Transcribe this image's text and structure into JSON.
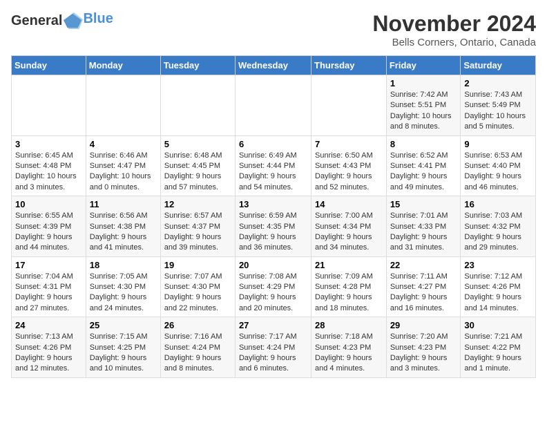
{
  "header": {
    "logo_general": "General",
    "logo_blue": "Blue",
    "month_title": "November 2024",
    "location": "Bells Corners, Ontario, Canada"
  },
  "weekdays": [
    "Sunday",
    "Monday",
    "Tuesday",
    "Wednesday",
    "Thursday",
    "Friday",
    "Saturday"
  ],
  "weeks": [
    [
      {
        "day": "",
        "info": ""
      },
      {
        "day": "",
        "info": ""
      },
      {
        "day": "",
        "info": ""
      },
      {
        "day": "",
        "info": ""
      },
      {
        "day": "",
        "info": ""
      },
      {
        "day": "1",
        "info": "Sunrise: 7:42 AM\nSunset: 5:51 PM\nDaylight: 10 hours and 8 minutes."
      },
      {
        "day": "2",
        "info": "Sunrise: 7:43 AM\nSunset: 5:49 PM\nDaylight: 10 hours and 5 minutes."
      }
    ],
    [
      {
        "day": "3",
        "info": "Sunrise: 6:45 AM\nSunset: 4:48 PM\nDaylight: 10 hours and 3 minutes."
      },
      {
        "day": "4",
        "info": "Sunrise: 6:46 AM\nSunset: 4:47 PM\nDaylight: 10 hours and 0 minutes."
      },
      {
        "day": "5",
        "info": "Sunrise: 6:48 AM\nSunset: 4:45 PM\nDaylight: 9 hours and 57 minutes."
      },
      {
        "day": "6",
        "info": "Sunrise: 6:49 AM\nSunset: 4:44 PM\nDaylight: 9 hours and 54 minutes."
      },
      {
        "day": "7",
        "info": "Sunrise: 6:50 AM\nSunset: 4:43 PM\nDaylight: 9 hours and 52 minutes."
      },
      {
        "day": "8",
        "info": "Sunrise: 6:52 AM\nSunset: 4:41 PM\nDaylight: 9 hours and 49 minutes."
      },
      {
        "day": "9",
        "info": "Sunrise: 6:53 AM\nSunset: 4:40 PM\nDaylight: 9 hours and 46 minutes."
      }
    ],
    [
      {
        "day": "10",
        "info": "Sunrise: 6:55 AM\nSunset: 4:39 PM\nDaylight: 9 hours and 44 minutes."
      },
      {
        "day": "11",
        "info": "Sunrise: 6:56 AM\nSunset: 4:38 PM\nDaylight: 9 hours and 41 minutes."
      },
      {
        "day": "12",
        "info": "Sunrise: 6:57 AM\nSunset: 4:37 PM\nDaylight: 9 hours and 39 minutes."
      },
      {
        "day": "13",
        "info": "Sunrise: 6:59 AM\nSunset: 4:35 PM\nDaylight: 9 hours and 36 minutes."
      },
      {
        "day": "14",
        "info": "Sunrise: 7:00 AM\nSunset: 4:34 PM\nDaylight: 9 hours and 34 minutes."
      },
      {
        "day": "15",
        "info": "Sunrise: 7:01 AM\nSunset: 4:33 PM\nDaylight: 9 hours and 31 minutes."
      },
      {
        "day": "16",
        "info": "Sunrise: 7:03 AM\nSunset: 4:32 PM\nDaylight: 9 hours and 29 minutes."
      }
    ],
    [
      {
        "day": "17",
        "info": "Sunrise: 7:04 AM\nSunset: 4:31 PM\nDaylight: 9 hours and 27 minutes."
      },
      {
        "day": "18",
        "info": "Sunrise: 7:05 AM\nSunset: 4:30 PM\nDaylight: 9 hours and 24 minutes."
      },
      {
        "day": "19",
        "info": "Sunrise: 7:07 AM\nSunset: 4:30 PM\nDaylight: 9 hours and 22 minutes."
      },
      {
        "day": "20",
        "info": "Sunrise: 7:08 AM\nSunset: 4:29 PM\nDaylight: 9 hours and 20 minutes."
      },
      {
        "day": "21",
        "info": "Sunrise: 7:09 AM\nSunset: 4:28 PM\nDaylight: 9 hours and 18 minutes."
      },
      {
        "day": "22",
        "info": "Sunrise: 7:11 AM\nSunset: 4:27 PM\nDaylight: 9 hours and 16 minutes."
      },
      {
        "day": "23",
        "info": "Sunrise: 7:12 AM\nSunset: 4:26 PM\nDaylight: 9 hours and 14 minutes."
      }
    ],
    [
      {
        "day": "24",
        "info": "Sunrise: 7:13 AM\nSunset: 4:26 PM\nDaylight: 9 hours and 12 minutes."
      },
      {
        "day": "25",
        "info": "Sunrise: 7:15 AM\nSunset: 4:25 PM\nDaylight: 9 hours and 10 minutes."
      },
      {
        "day": "26",
        "info": "Sunrise: 7:16 AM\nSunset: 4:24 PM\nDaylight: 9 hours and 8 minutes."
      },
      {
        "day": "27",
        "info": "Sunrise: 7:17 AM\nSunset: 4:24 PM\nDaylight: 9 hours and 6 minutes."
      },
      {
        "day": "28",
        "info": "Sunrise: 7:18 AM\nSunset: 4:23 PM\nDaylight: 9 hours and 4 minutes."
      },
      {
        "day": "29",
        "info": "Sunrise: 7:20 AM\nSunset: 4:23 PM\nDaylight: 9 hours and 3 minutes."
      },
      {
        "day": "30",
        "info": "Sunrise: 7:21 AM\nSunset: 4:22 PM\nDaylight: 9 hours and 1 minute."
      }
    ]
  ]
}
